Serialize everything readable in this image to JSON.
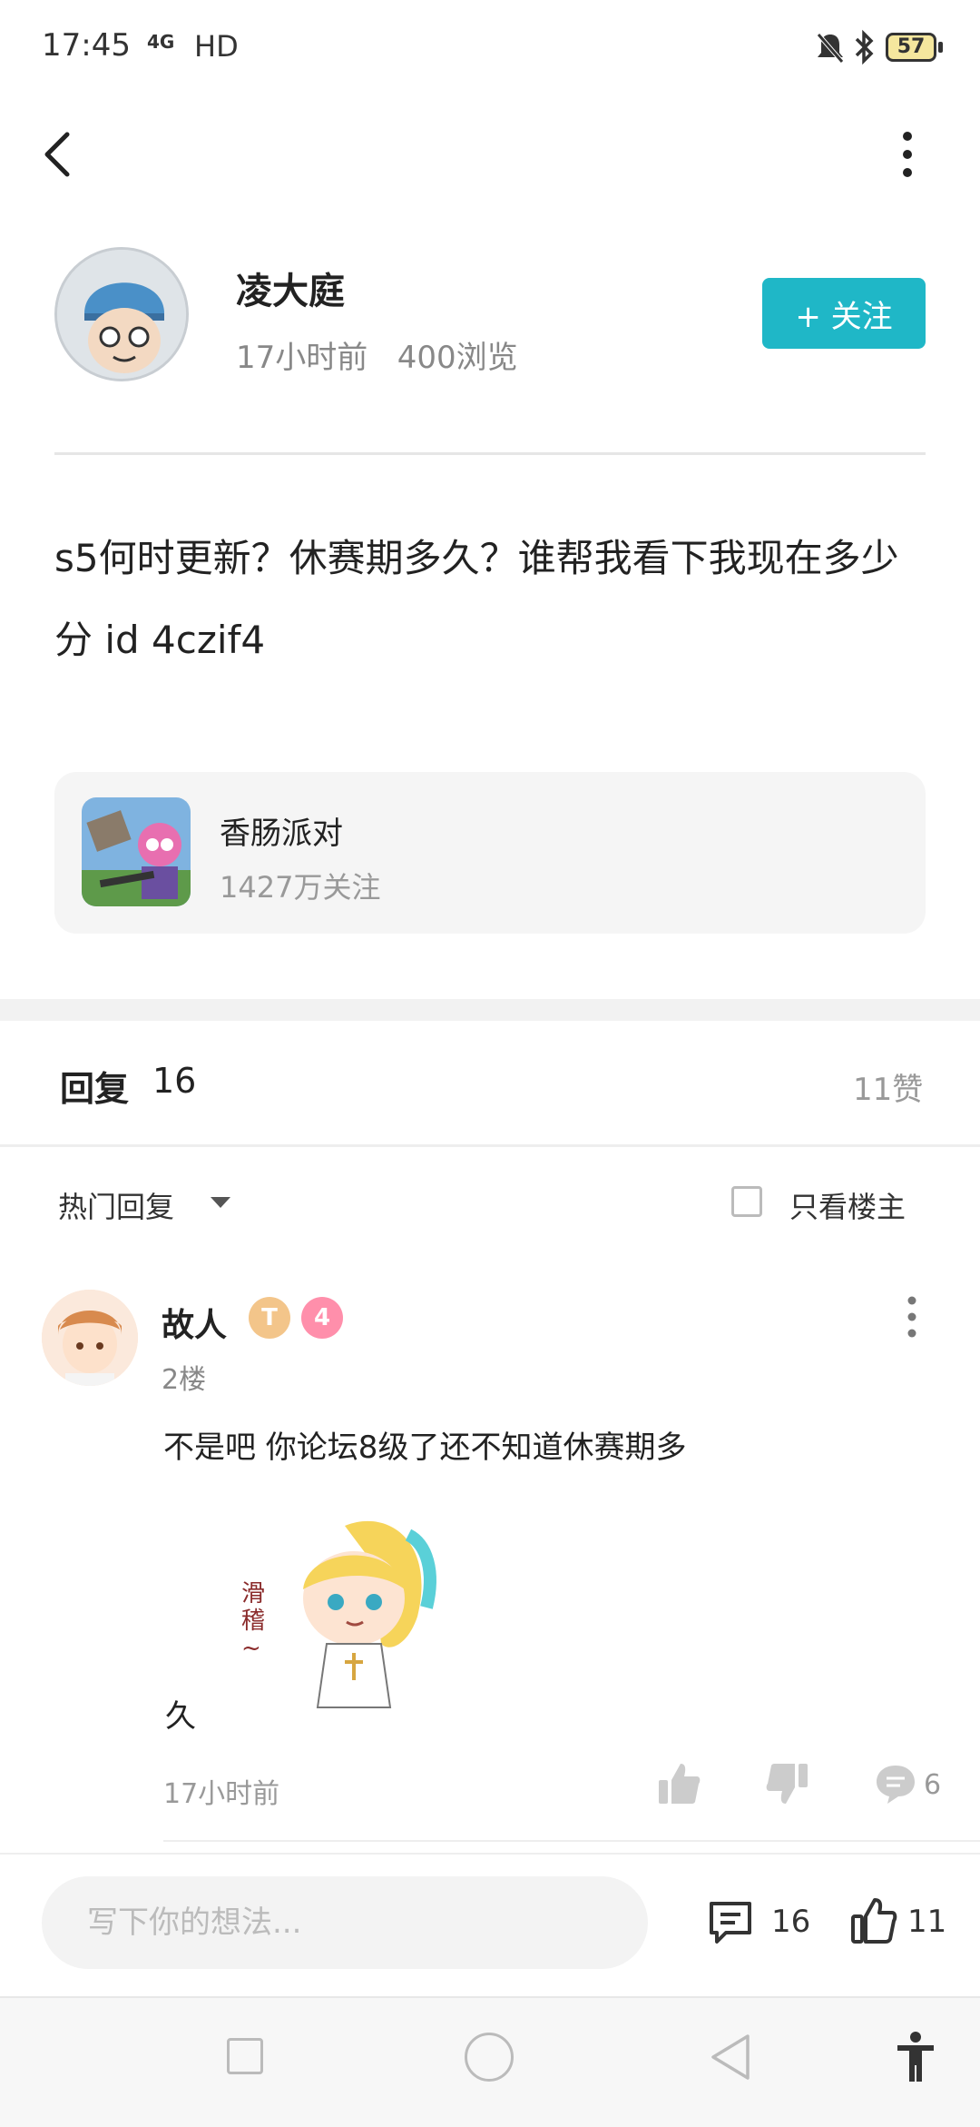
{
  "status_bar": {
    "time": "17:45",
    "network": "4G",
    "hd": "HD",
    "battery": "57"
  },
  "author": {
    "name": "凌大庭",
    "time": "17小时前",
    "views": "400浏览",
    "follow_label": "+ 关注"
  },
  "post": {
    "text": "s5何时更新？休赛期多久？谁帮我看下我现在多少分 id 4czif4"
  },
  "game": {
    "name": "香肠派对",
    "followers": "1427万关注"
  },
  "replies_header": {
    "title": "回复",
    "count": "16",
    "likes": "11赞"
  },
  "filter": {
    "sort_label": "热门回复",
    "owner_only_label": "只看楼主"
  },
  "reply": {
    "user": "故人",
    "badge_t": "T",
    "badge_level": "4",
    "floor": "2楼",
    "text": "不是吧 你论坛8级了还不知道休赛期多",
    "text_end": "久",
    "sticker_text": "滑稽~",
    "time": "17小时前",
    "comment_count": "6"
  },
  "composer": {
    "placeholder": "写下你的想法...",
    "comment_count": "16",
    "like_count": "11"
  },
  "colors": {
    "accent": "#1fb7c7",
    "badge_level": "#ff8fab",
    "badge_t": "#f3c58a"
  },
  "icons": [
    "back-icon",
    "more-icon",
    "check-box-icon",
    "thumb-up-icon",
    "thumb-down-icon",
    "comment-icon",
    "accessibility-icon"
  ]
}
